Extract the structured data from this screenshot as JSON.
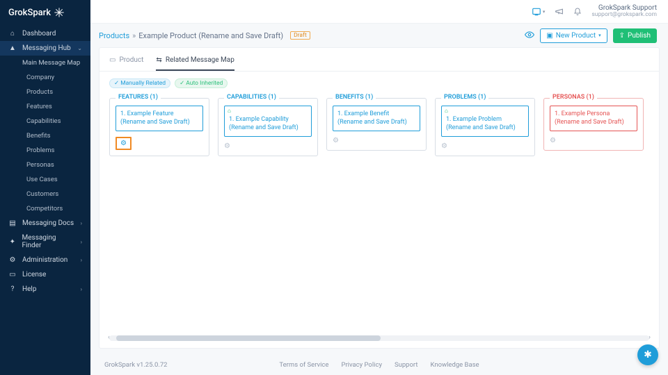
{
  "brand": "GrokSpark",
  "user": {
    "name": "GrokSpark Support",
    "email": "support@grokspark.com"
  },
  "topbar": {
    "help_caret": "▾"
  },
  "sidebar": {
    "items": [
      {
        "icon": "⌂",
        "label": "Dashboard"
      },
      {
        "icon": "▲",
        "label": "Messaging Hub",
        "expanded": true,
        "section": true
      },
      {
        "label": "Main Message Map",
        "sub": true
      },
      {
        "label": "Company",
        "subsub": true
      },
      {
        "label": "Products",
        "subsub": true
      },
      {
        "label": "Features",
        "subsub": true
      },
      {
        "label": "Capabilities",
        "subsub": true
      },
      {
        "label": "Benefits",
        "subsub": true
      },
      {
        "label": "Problems",
        "subsub": true
      },
      {
        "label": "Personas",
        "subsub": true
      },
      {
        "label": "Use Cases",
        "subsub": true
      },
      {
        "label": "Customers",
        "subsub": true
      },
      {
        "label": "Competitors",
        "subsub": true
      },
      {
        "icon": "▤",
        "label": "Messaging Docs",
        "chev": true
      },
      {
        "icon": "✦",
        "label": "Messaging Finder",
        "chev": true
      },
      {
        "icon": "⚙",
        "label": "Administration",
        "chev": true
      },
      {
        "icon": "▭",
        "label": "License"
      },
      {
        "icon": "?",
        "label": "Help",
        "chev": true
      }
    ]
  },
  "breadcrumb": {
    "root": "Products",
    "current": "Example Product (Rename and Save Draft)",
    "badge": "Draft"
  },
  "actions": {
    "new_product": "New Product",
    "publish": "Publish"
  },
  "tabs": [
    {
      "icon": "▭",
      "label": "Product"
    },
    {
      "icon": "⇆",
      "label": "Related Message Map",
      "active": true
    }
  ],
  "chips": [
    {
      "style": "blue",
      "label": "✓ Manually Related"
    },
    {
      "style": "green",
      "label": "✓ Auto Inherited"
    }
  ],
  "columns": [
    {
      "title": "FEATURES (1)",
      "card": "1. Example Feature (Rename and Save Draft)",
      "boxed_gear": true
    },
    {
      "title": "CAPABILITIES (1)",
      "card": "1. Example Capability (Rename and Save Draft)",
      "tag": true
    },
    {
      "title": "BENEFITS (1)",
      "card": "1. Example Benefit (Rename and Save Draft)"
    },
    {
      "title": "PROBLEMS (1)",
      "card": "1. Example Problem (Rename and Save Draft)",
      "tag": true
    },
    {
      "title": "PERSONAS (1)",
      "card": "1. Example Persona (Rename and Save Draft)",
      "red": true
    }
  ],
  "footer": {
    "version": "GrokSpark v1.25.0.72",
    "links": [
      "Terms of Service",
      "Privacy Policy",
      "Support",
      "Knowledge Base"
    ]
  }
}
